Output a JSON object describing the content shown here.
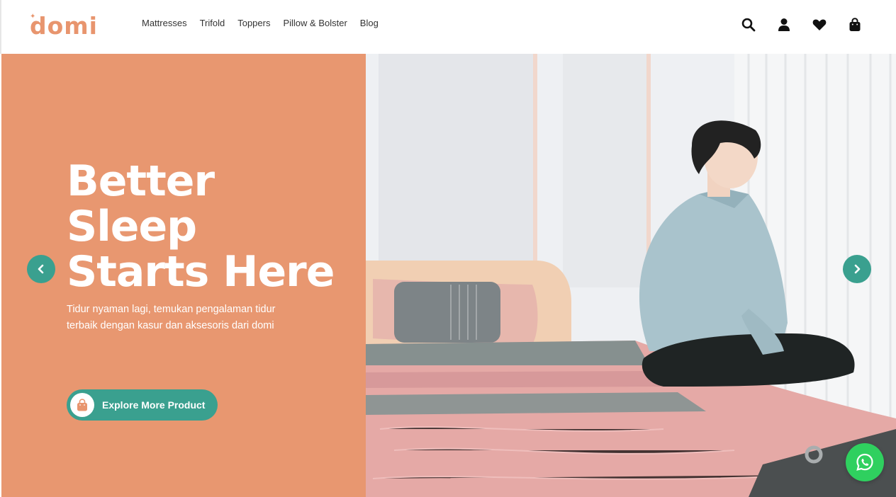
{
  "brand": {
    "name": "domi",
    "color": "#e8956e"
  },
  "nav": {
    "items": [
      {
        "label": "Mattresses"
      },
      {
        "label": "Trifold"
      },
      {
        "label": "Toppers"
      },
      {
        "label": "Pillow & Bolster"
      },
      {
        "label": "Blog"
      }
    ]
  },
  "header_icons": [
    "search-icon",
    "user-icon",
    "heart-icon",
    "shopping-bag-icon"
  ],
  "hero": {
    "headline": [
      "Better",
      "Sleep",
      "Starts Here"
    ],
    "subtext": "Tidur nyaman lagi, temukan pengalaman tidur terbaik dengan kasur dan aksesoris dari domi",
    "cta_label": "Explore More Product",
    "panel_color": "#e89770",
    "accent_color": "#3aa08f"
  },
  "floating": {
    "whatsapp_color": "#2fd05f"
  }
}
